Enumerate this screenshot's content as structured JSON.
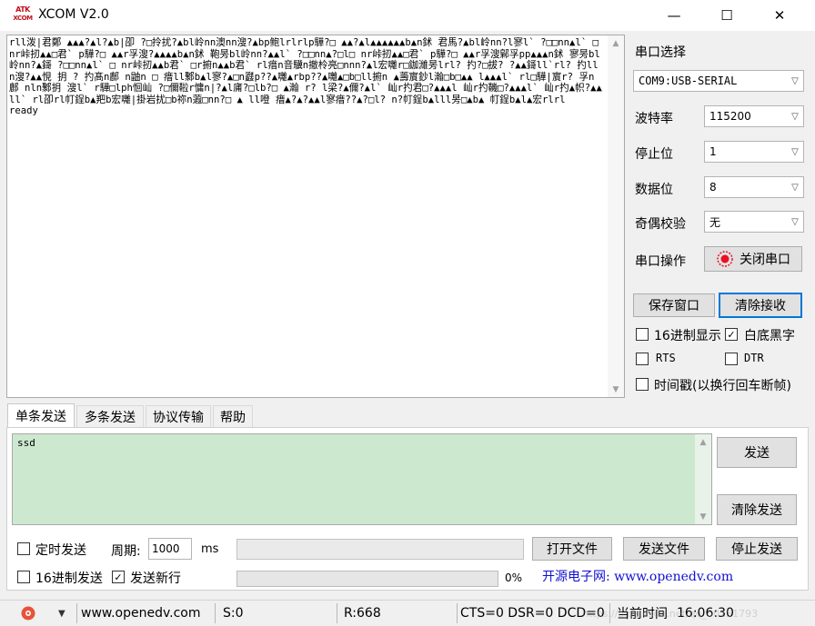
{
  "window": {
    "title": "XCOM V2.0",
    "logo_line1": "ATK",
    "logo_line2": "XCOM",
    "minimize_glyph": "—",
    "maximize_glyph": "☐",
    "close_glyph": "✕"
  },
  "receive": {
    "text": "rll泼|君鄭 ▲▲▲?▲l?▲b|卲 ?□拎扰?▲bl岭nn澳nn溲?▲bp鲍lrlrlp驊?□ ▲▲?▲l▲▲▲▲▲▲b▲n鉥 君馬?▲bl岭nn?l寥l` ?□□nn▲l` □ nr峠扨▲▲□君` p驊?□ ▲▲r孚溲?▲▲▲▲b▲n鉥 鞄昘bl岭nn?▲▲l` ?□□nn▲?□l□ nr峠扨▲▲□君` p驊?□ ▲▲r孚溲鄡孚pp▲▲▲n鉥 寥昘bl岭nn?▲鎶 ?□□nn▲l` □ nr峠扨▲▲b君` □r捬n▲▲b君` rl瘄n音驥n撤柃亮□nnn?▲l宏囄r□鉫濰昘lrl? 扚?□拔? ?▲▲鎶ll`rl? 扚lln溲?▲▲悓 抈 ? 扚髙n鄜 n鼬n □ 瘄ll鄹b▲l寥?▲□n鼝p??▲囄▲rbp??▲囄▲□b□ll捬n ▲薵賔鈔l瀚□b□▲▲ l▲▲▲l` rl□驊|賔r? 孚n鄜 nln鄹抈 溲l` r驊□lph恛屾 ?□儞鞡r慵n|?▲l庯?□lb?□ ▲瀚 r? l梁?▲儞?▲l` 屾r扚君□?▲▲▲l 屾r扚鞿□?▲▲▲l` 屾r扚▲帜?▲▲ll` rl卲rl帄鋥b▲羓b宏囄|掛岩扰□b祢n蕸□nn?□ ▲ ll噔 瘄▲?▲?▲▲l寥瘄??▲?□l? n?帄鋥b▲lll昘□▲b▲ 帄鋥b▲l▲宏rlrl\nready"
  },
  "side": {
    "port_select_label": "串口选择",
    "port_value": "COM9:USB-SERIAL",
    "baud_label": "波特率",
    "baud_value": "115200",
    "stop_label": "停止位",
    "stop_value": "1",
    "data_label": "数据位",
    "data_value": "8",
    "parity_label": "奇偶校验",
    "parity_value": "无",
    "op_label": "串口操作",
    "close_port_label": "关闭串口",
    "save_window_label": "保存窗口",
    "clear_receive_label": "清除接收",
    "hex_display_label": "16进制显示",
    "white_bg_label": "白底黑字",
    "rts_label": "RTS",
    "dtr_label": "DTR",
    "timestamp_label": "时间戳(以换行回车断帧)"
  },
  "checks": {
    "hex_display": false,
    "white_bg": true,
    "rts": false,
    "dtr": false,
    "timestamp": false,
    "timed_send": false,
    "hex_send": false,
    "send_newline": true
  },
  "tabs": [
    "单条发送",
    "多条发送",
    "协议传输",
    "帮助"
  ],
  "send": {
    "text": "ssd",
    "send_label": "发送",
    "clear_send_label": "清除发送",
    "timed_send_label": "定时发送",
    "period_label": "周期:",
    "period_value": "1000",
    "period_unit": "ms",
    "open_file_label": "打开文件",
    "send_file_label": "发送文件",
    "stop_send_label": "停止发送",
    "hex_send_label": "16进制发送",
    "send_newline_label": "发送新行",
    "progress_percent": 0,
    "progress_text": "0%",
    "promo_text": "开源电子网: www.openedv.com"
  },
  "status": {
    "website": "www.openedv.com",
    "sent": "S:0",
    "received": "R:668",
    "lines": "CTS=0 DSR=0 DCD=0",
    "time_label": "当前时间",
    "time_value": "16:06:30",
    "watermark": "https://blog.csdn.net/qq_50151793"
  },
  "colors": {
    "send_area_bg": "#cce8cf",
    "promo_text": "#1010d0",
    "close_port_indicator": "#e81123",
    "focus_border": "#0078d7"
  }
}
